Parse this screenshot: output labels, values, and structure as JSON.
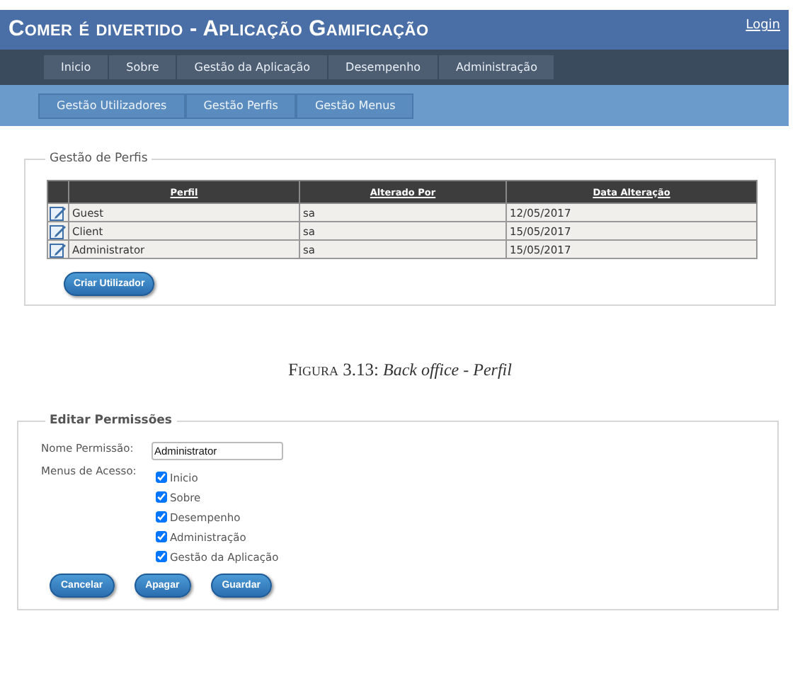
{
  "app_header": {
    "title": "Comer é divertido - Aplicação Gamificação",
    "login_link": "Login"
  },
  "main_menu": [
    {
      "label": "Inicio"
    },
    {
      "label": "Sobre"
    },
    {
      "label": "Gestão da Aplicação"
    },
    {
      "label": "Desempenho"
    },
    {
      "label": "Administração"
    }
  ],
  "sub_menu": [
    {
      "label": "Gestão Utilizadores"
    },
    {
      "label": "Gestão Perfis"
    },
    {
      "label": "Gestão Menus"
    }
  ],
  "profiles_panel": {
    "legend": "Gestão de Perfis",
    "columns": [
      "Perfil",
      "Alterado Por",
      "Data Alteração"
    ],
    "rows": [
      [
        "Guest",
        "sa",
        "12/05/2017"
      ],
      [
        "Client",
        "sa",
        "15/05/2017"
      ],
      [
        "Administrator",
        "sa",
        "15/05/2017"
      ]
    ],
    "button": "Criar Utilizador"
  },
  "figure_caption": {
    "label": "Figura 3.13:",
    "text": "Back office - Perfil"
  },
  "permissions_panel": {
    "legend": "Editar Permissões",
    "name_label": "Nome Permissão:",
    "name_value": "Administrator",
    "menus_label": "Menus de Acesso:",
    "menus": [
      {
        "label": "Inicio",
        "checked": true
      },
      {
        "label": "Sobre",
        "checked": true
      },
      {
        "label": "Desempenho",
        "checked": true
      },
      {
        "label": "Administração",
        "checked": true
      },
      {
        "label": "Gestão da Aplicação",
        "checked": true
      }
    ],
    "buttons": [
      "Cancelar",
      "Apagar",
      "Guardar"
    ]
  }
}
